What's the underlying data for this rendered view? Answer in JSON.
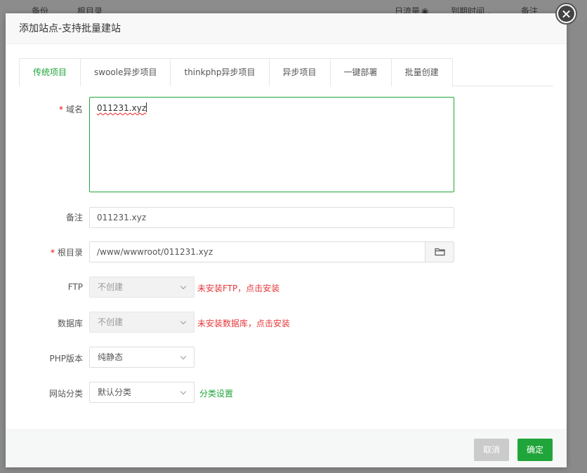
{
  "background": {
    "columns": [
      "备份",
      "根目录",
      "日流量",
      "到期时间",
      "备注"
    ]
  },
  "modal": {
    "title": "添加站点-支持批量建站",
    "tabs": [
      "传统项目",
      "swoole异步项目",
      "thinkphp异步项目",
      "异步项目",
      "一键部署",
      "批量创建"
    ],
    "active_tab": 0
  },
  "form": {
    "domain": {
      "label": "域名",
      "required_mark": "*",
      "value": "011231.xyz"
    },
    "remark": {
      "label": "备注",
      "value": "011231.xyz"
    },
    "root": {
      "label": "根目录",
      "required_mark": "*",
      "value": "/www/wwwroot/011231.xyz"
    },
    "ftp": {
      "label": "FTP",
      "value": "不创建",
      "hint": "未安装FTP，点击安装"
    },
    "database": {
      "label": "数据库",
      "value": "不创建",
      "hint": "未安装数据库，点击安装"
    },
    "php": {
      "label": "PHP版本",
      "value": "纯静态"
    },
    "category": {
      "label": "网站分类",
      "value": "默认分类",
      "link": "分类设置"
    }
  },
  "footer": {
    "cancel": "取消",
    "confirm": "确定"
  },
  "colors": {
    "accent": "#20a53a",
    "error": "#e4393c"
  }
}
